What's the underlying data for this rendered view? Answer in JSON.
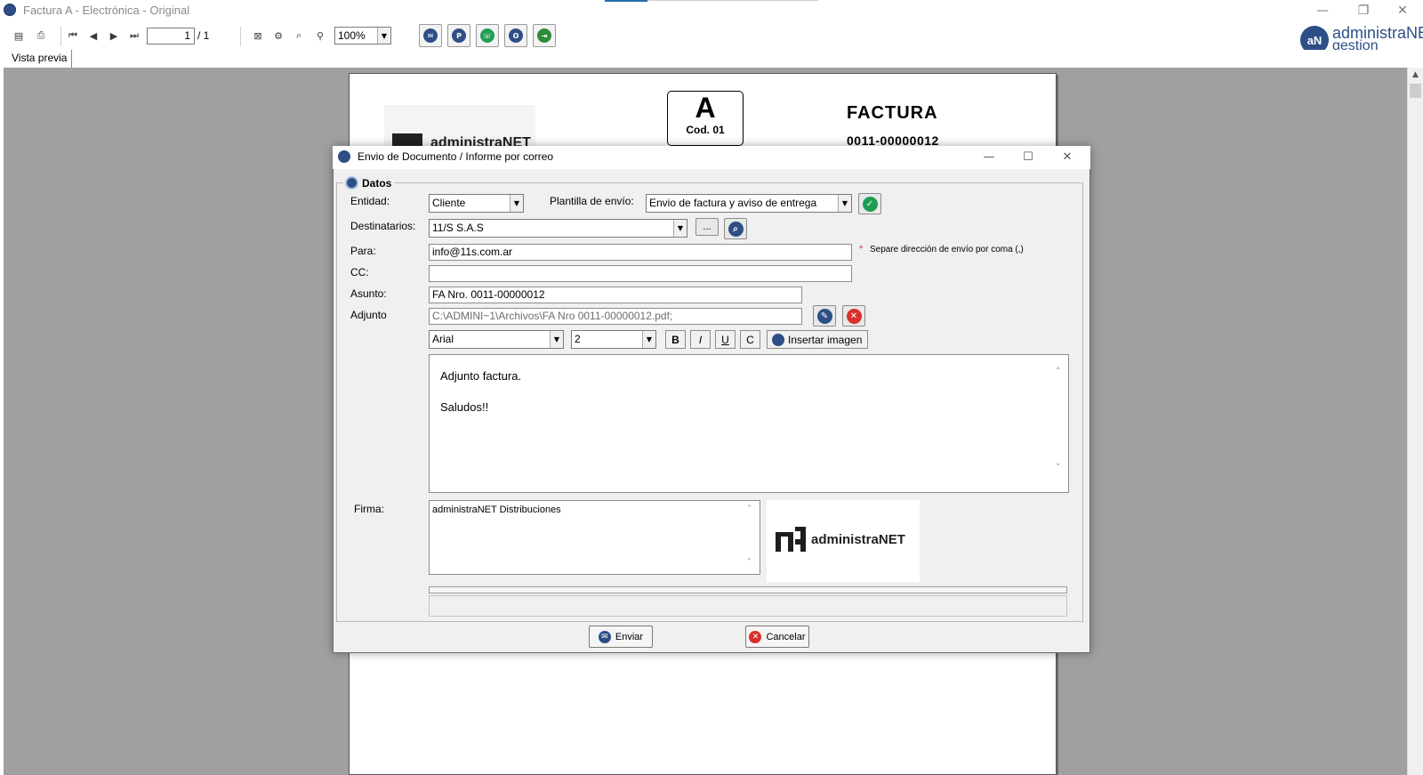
{
  "window": {
    "title": "Factura A - Electrónica - Original",
    "minimize_glyph": "—",
    "restore_glyph": "❐",
    "close_glyph": "✕"
  },
  "toolbar": {
    "page_current": "1",
    "page_total": "/ 1",
    "zoom": "100%",
    "icons": [
      "export-icon",
      "print-icon",
      "first-page-icon",
      "prev-page-icon",
      "next-page-icon",
      "last-page-icon",
      "close-preview-icon",
      "tools-icon",
      "find-icon",
      "binoculars-icon"
    ],
    "actions": [
      {
        "name": "email-icon",
        "color": "#2d4f86"
      },
      {
        "name": "pdf-icon",
        "color": "#2d4f86"
      },
      {
        "name": "whatsapp-icon",
        "color": "#1f9d55"
      },
      {
        "name": "outlook-icon",
        "color": "#2d4f86"
      },
      {
        "name": "exit-icon",
        "color": "#2e8b3a"
      }
    ]
  },
  "brand": {
    "initials": "aN",
    "line1": "administraNET",
    "line2": "gestion",
    "color": "#2d4f86"
  },
  "tabs": {
    "preview": "Vista previa"
  },
  "document": {
    "letter": "A",
    "code": "Cod. 01",
    "title": "FACTURA",
    "number": "0011-00000012",
    "logo_text": "administraNET"
  },
  "dialog": {
    "title": "Envio de Documento / Informe por correo",
    "group_title": "Datos",
    "labels": {
      "entidad": "Entidad:",
      "plantilla": "Plantilla de envío:",
      "destinatarios": "Destinatarios:",
      "para": "Para:",
      "cc": "CC:",
      "asunto": "Asunto:",
      "adjunto": "Adjunto",
      "firma": "Firma:"
    },
    "values": {
      "entidad": "Cliente",
      "plantilla": "Envio de factura y aviso de entrega",
      "destinatarios": "11/S S.A.S",
      "para": "info@11s.com.ar",
      "cc": "",
      "asunto": "FA Nro. 0011-00000012",
      "adjunto": "C:\\ADMINI~1\\Archivos\\FA Nro 0011-00000012.pdf;",
      "font": "Arial",
      "size": "2",
      "firma": "administraNET Distribuciones",
      "firma_logo": "administraNET"
    },
    "hint_star": "*",
    "hint": "Separe dirección de envío por coma (,)",
    "browse_label": "...",
    "format_buttons": {
      "bold": "B",
      "italic": "I",
      "underline": "U",
      "strike": "C"
    },
    "insert_image": "Insertar imagen",
    "body_lines": [
      "Adjunto factura.",
      "Saludos!!"
    ],
    "send": "Enviar",
    "cancel": "Cancelar",
    "colors": {
      "confirm": "#1f9d55",
      "cancel": "#d9302c",
      "accent": "#2d4f86",
      "hint_star": "#d9302c"
    }
  }
}
